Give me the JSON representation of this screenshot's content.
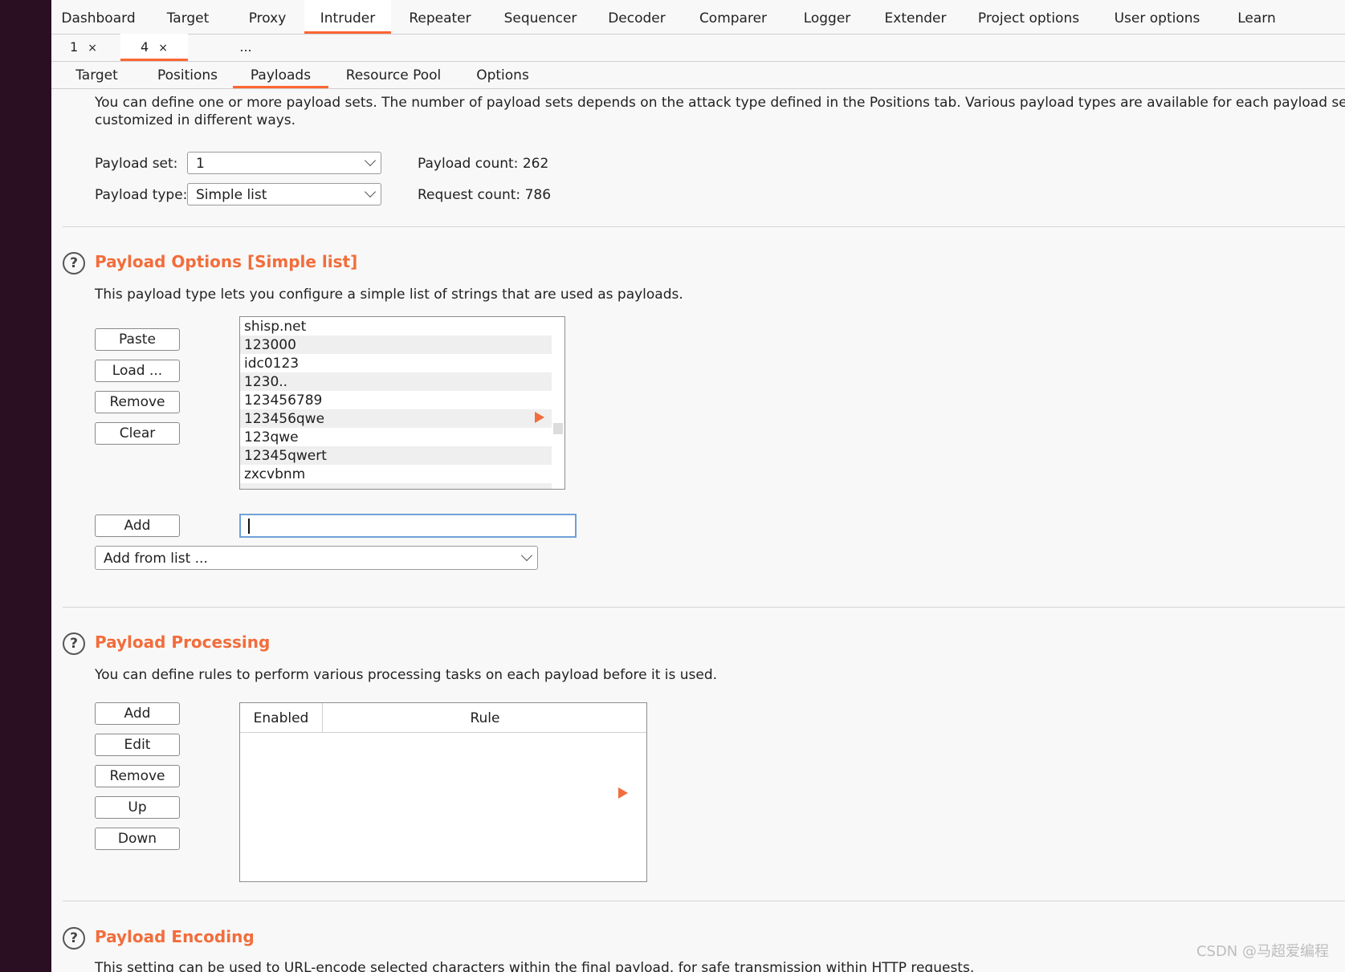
{
  "main_tabs": [
    "Dashboard",
    "Target",
    "Proxy",
    "Intruder",
    "Repeater",
    "Sequencer",
    "Decoder",
    "Comparer",
    "Logger",
    "Extender",
    "Project options",
    "User options",
    "Learn"
  ],
  "sub_tabs": [
    {
      "label": "1",
      "close": "×"
    },
    {
      "label": "4",
      "close": "×"
    },
    {
      "label": "..."
    }
  ],
  "payload_tabs": [
    "Target",
    "Positions",
    "Payloads",
    "Resource Pool",
    "Options"
  ],
  "intro": {
    "line1": "You can define one or more payload sets. The number of payload sets depends on the attack type defined in the Positions tab. Various payload types are available for each payload set, and ea",
    "line2": "customized in different ways."
  },
  "payload_set": {
    "label": "Payload set:",
    "value": "1"
  },
  "payload_type": {
    "label": "Payload type:",
    "value": "Simple list"
  },
  "payload_count": {
    "label": "Payload count:",
    "value": "262"
  },
  "request_count": {
    "label": "Request count:",
    "value": "786"
  },
  "options_section": {
    "title": "Payload Options [Simple list]",
    "description": "This payload type lets you configure a simple list of strings that are used as payloads.",
    "buttons": {
      "paste": "Paste",
      "load": "Load ...",
      "remove": "Remove",
      "clear": "Clear",
      "add": "Add"
    },
    "items": [
      "shisp.net",
      "123000",
      "idc0123",
      "1230..",
      "123456789",
      "123456qwe",
      "123qwe",
      "12345qwert",
      "zxcvbnm"
    ],
    "add_from_list": "Add from list ..."
  },
  "processing_section": {
    "title": "Payload Processing",
    "description": "You can define rules to perform various processing tasks on each payload before it is used.",
    "buttons": {
      "add": "Add",
      "edit": "Edit",
      "remove": "Remove",
      "up": "Up",
      "down": "Down"
    },
    "columns": {
      "enabled": "Enabled",
      "rule": "Rule"
    }
  },
  "encoding_section": {
    "title": "Payload Encoding",
    "description": "This setting can be used to URL-encode selected characters within the final payload, for safe transmission within HTTP requests."
  },
  "help_glyph": "?",
  "watermark": "CSDN @马超爱编程",
  "colors": {
    "accent": "#f26d3b",
    "background": "#f8f8f8",
    "desktop": "#2a0f23",
    "input_focus": "#6fa0d8"
  }
}
